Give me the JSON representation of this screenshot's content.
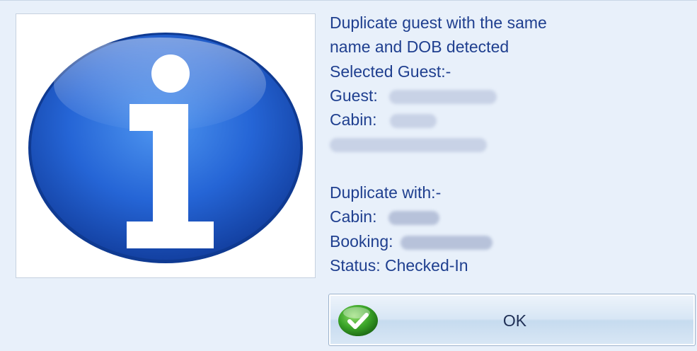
{
  "icons": {
    "main": "info-icon",
    "ok": "checkmark-icon"
  },
  "message": {
    "line1": "Duplicate guest with the same",
    "line2": "name and DOB detected",
    "selected_header": "Selected Guest:-",
    "guest_label": "Guest:",
    "cabin_label": "Cabin:",
    "duplicate_header": "Duplicate with:-",
    "dup_cabin_label": "Cabin:",
    "booking_label": "Booking:",
    "status_label": "Status: Checked-In"
  },
  "ok_button": {
    "label": "OK"
  },
  "colors": {
    "dialog_bg": "#e8f0fa",
    "text": "#1f3f8f",
    "icon_blue": "#1f5fd0",
    "check_green": "#3aa428"
  }
}
